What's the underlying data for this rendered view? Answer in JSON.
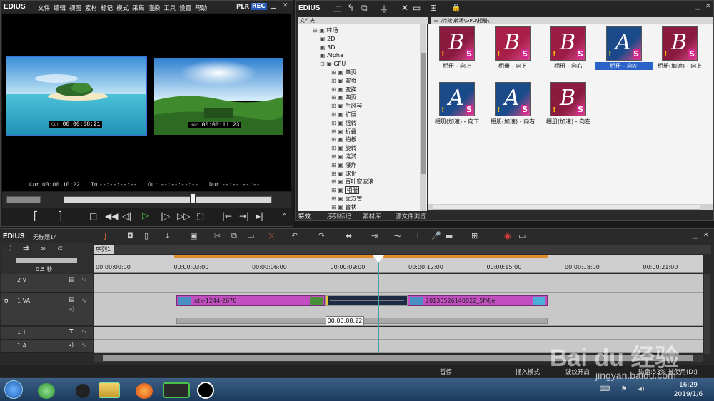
{
  "player": {
    "logo": "EDIUS",
    "menu": [
      "文件",
      "编辑",
      "视图",
      "素材",
      "标记",
      "模式",
      "采集",
      "渲染",
      "工具",
      "设置",
      "帮助"
    ],
    "plr": "PLR",
    "rec": "REC",
    "src_timecode": "00:00:08:21",
    "rec_timecode": "00:00:11:23",
    "src_tc_prefix": "Cur",
    "rec_tc_prefix": "Rec",
    "cur_label": "Cur",
    "cur_value": "00:00:10:22",
    "in_label": "In",
    "in_value": "--:--:--:--",
    "out_label": "Out",
    "out_value": "--:--:--:--",
    "dur_label": "Dur",
    "dur_value": "--:--:--:--"
  },
  "bin": {
    "logo": "EDIUS",
    "folder_header": "文件夹",
    "path": "\\特效\\转场\\GPU\\相册\\",
    "tree": [
      {
        "label": "转场",
        "level": 1
      },
      {
        "label": "2D",
        "level": 2
      },
      {
        "label": "3D",
        "level": 2
      },
      {
        "label": "Alpha",
        "level": 2
      },
      {
        "label": "GPU",
        "level": 2
      },
      {
        "label": "单页",
        "level": 3
      },
      {
        "label": "双页",
        "level": 3
      },
      {
        "label": "变换",
        "level": 3
      },
      {
        "label": "四页",
        "level": 3
      },
      {
        "label": "手风琴",
        "level": 3
      },
      {
        "label": "扩展",
        "level": 3
      },
      {
        "label": "扭转",
        "level": 3
      },
      {
        "label": "折叠",
        "level": 3
      },
      {
        "label": "拍板",
        "level": 3
      },
      {
        "label": "旋转",
        "level": 3
      },
      {
        "label": "涟漪",
        "level": 3
      },
      {
        "label": "爆炸",
        "level": 3
      },
      {
        "label": "球化",
        "level": 3
      },
      {
        "label": "百叶窗波浪",
        "level": 3
      },
      {
        "label": "相册",
        "level": 3,
        "selected": true
      },
      {
        "label": "立方管",
        "level": 3
      },
      {
        "label": "管状",
        "level": 3
      }
    ],
    "items": [
      {
        "label": "相册 - 向上",
        "letter": "B",
        "bg": "#8b1a3f"
      },
      {
        "label": "相册 - 向下",
        "letter": "B",
        "bg": "#a8204a"
      },
      {
        "label": "相册 - 向右",
        "letter": "B",
        "bg": "#9b1c45"
      },
      {
        "label": "相册 - 向左",
        "letter": "A",
        "bg": "#1a4a8a",
        "selected": true
      },
      {
        "label": "相册(加速) - 向上",
        "letter": "B",
        "bg": "#8b1a3f"
      },
      {
        "label": "相册(加速) - 向下",
        "letter": "A",
        "bg": "#1a4a8a"
      },
      {
        "label": "相册(加速) - 向右",
        "letter": "A",
        "bg": "#1a4a8a"
      },
      {
        "label": "相册(加速) - 向左",
        "letter": "B",
        "bg": "#8b1a3f"
      }
    ],
    "tabs": [
      "特效",
      "序列标记",
      "素材库",
      "源文件浏览"
    ]
  },
  "timeline": {
    "logo": "EDIUS",
    "project": "无标题14",
    "sequence_tab": "序列1",
    "zoom": "0.5 秒",
    "ruler": [
      "00:00:00:00",
      "00:00:03:00",
      "00:00:06:00",
      "00:00:09:00",
      "00:00:12:00",
      "00:00:15:00",
      "00:00:18:00",
      "00:00:21:00"
    ],
    "tracks": {
      "v2": "2 V",
      "va1": "1 VA",
      "t1": "1 T",
      "a1": "1 A"
    },
    "clips": {
      "clip1": "ntk-1244-2676",
      "clip2": "20130526140022_5fMJe"
    },
    "tooltip": "00:00:08:22"
  },
  "statusbar": {
    "pause": "暂停",
    "insert_mode": "插入模式",
    "ripple": "波纹开启",
    "disk": "磁盘:53% 被使用(D:)"
  },
  "taskbar": {
    "time": "16:29",
    "date": "2019/1/6"
  },
  "watermark": {
    "brand": "Bai du 经验",
    "url": "jingyan.baidu.com"
  }
}
